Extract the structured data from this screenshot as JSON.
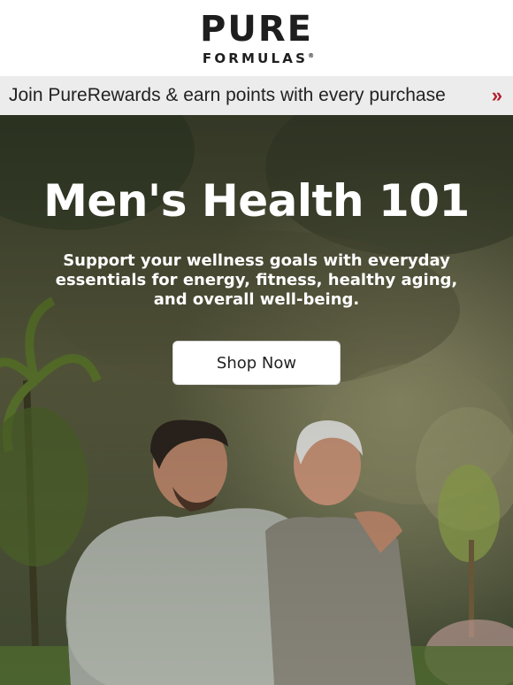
{
  "logo": {
    "main": "PURE",
    "sub": "FORMULAS",
    "mark": "®"
  },
  "rewards": {
    "text": "Join PureRewards & earn points with every purchase",
    "arrow": "»"
  },
  "hero": {
    "title": "Men's Health 101",
    "subtitle": "Support your wellness goals with everyday essentials for energy, fitness, healthy aging, and overall well-being.",
    "button_label": "Shop Now"
  },
  "colors": {
    "accent": "#b21f2d",
    "bar": "#ececec",
    "text": "#1e1e1e"
  }
}
